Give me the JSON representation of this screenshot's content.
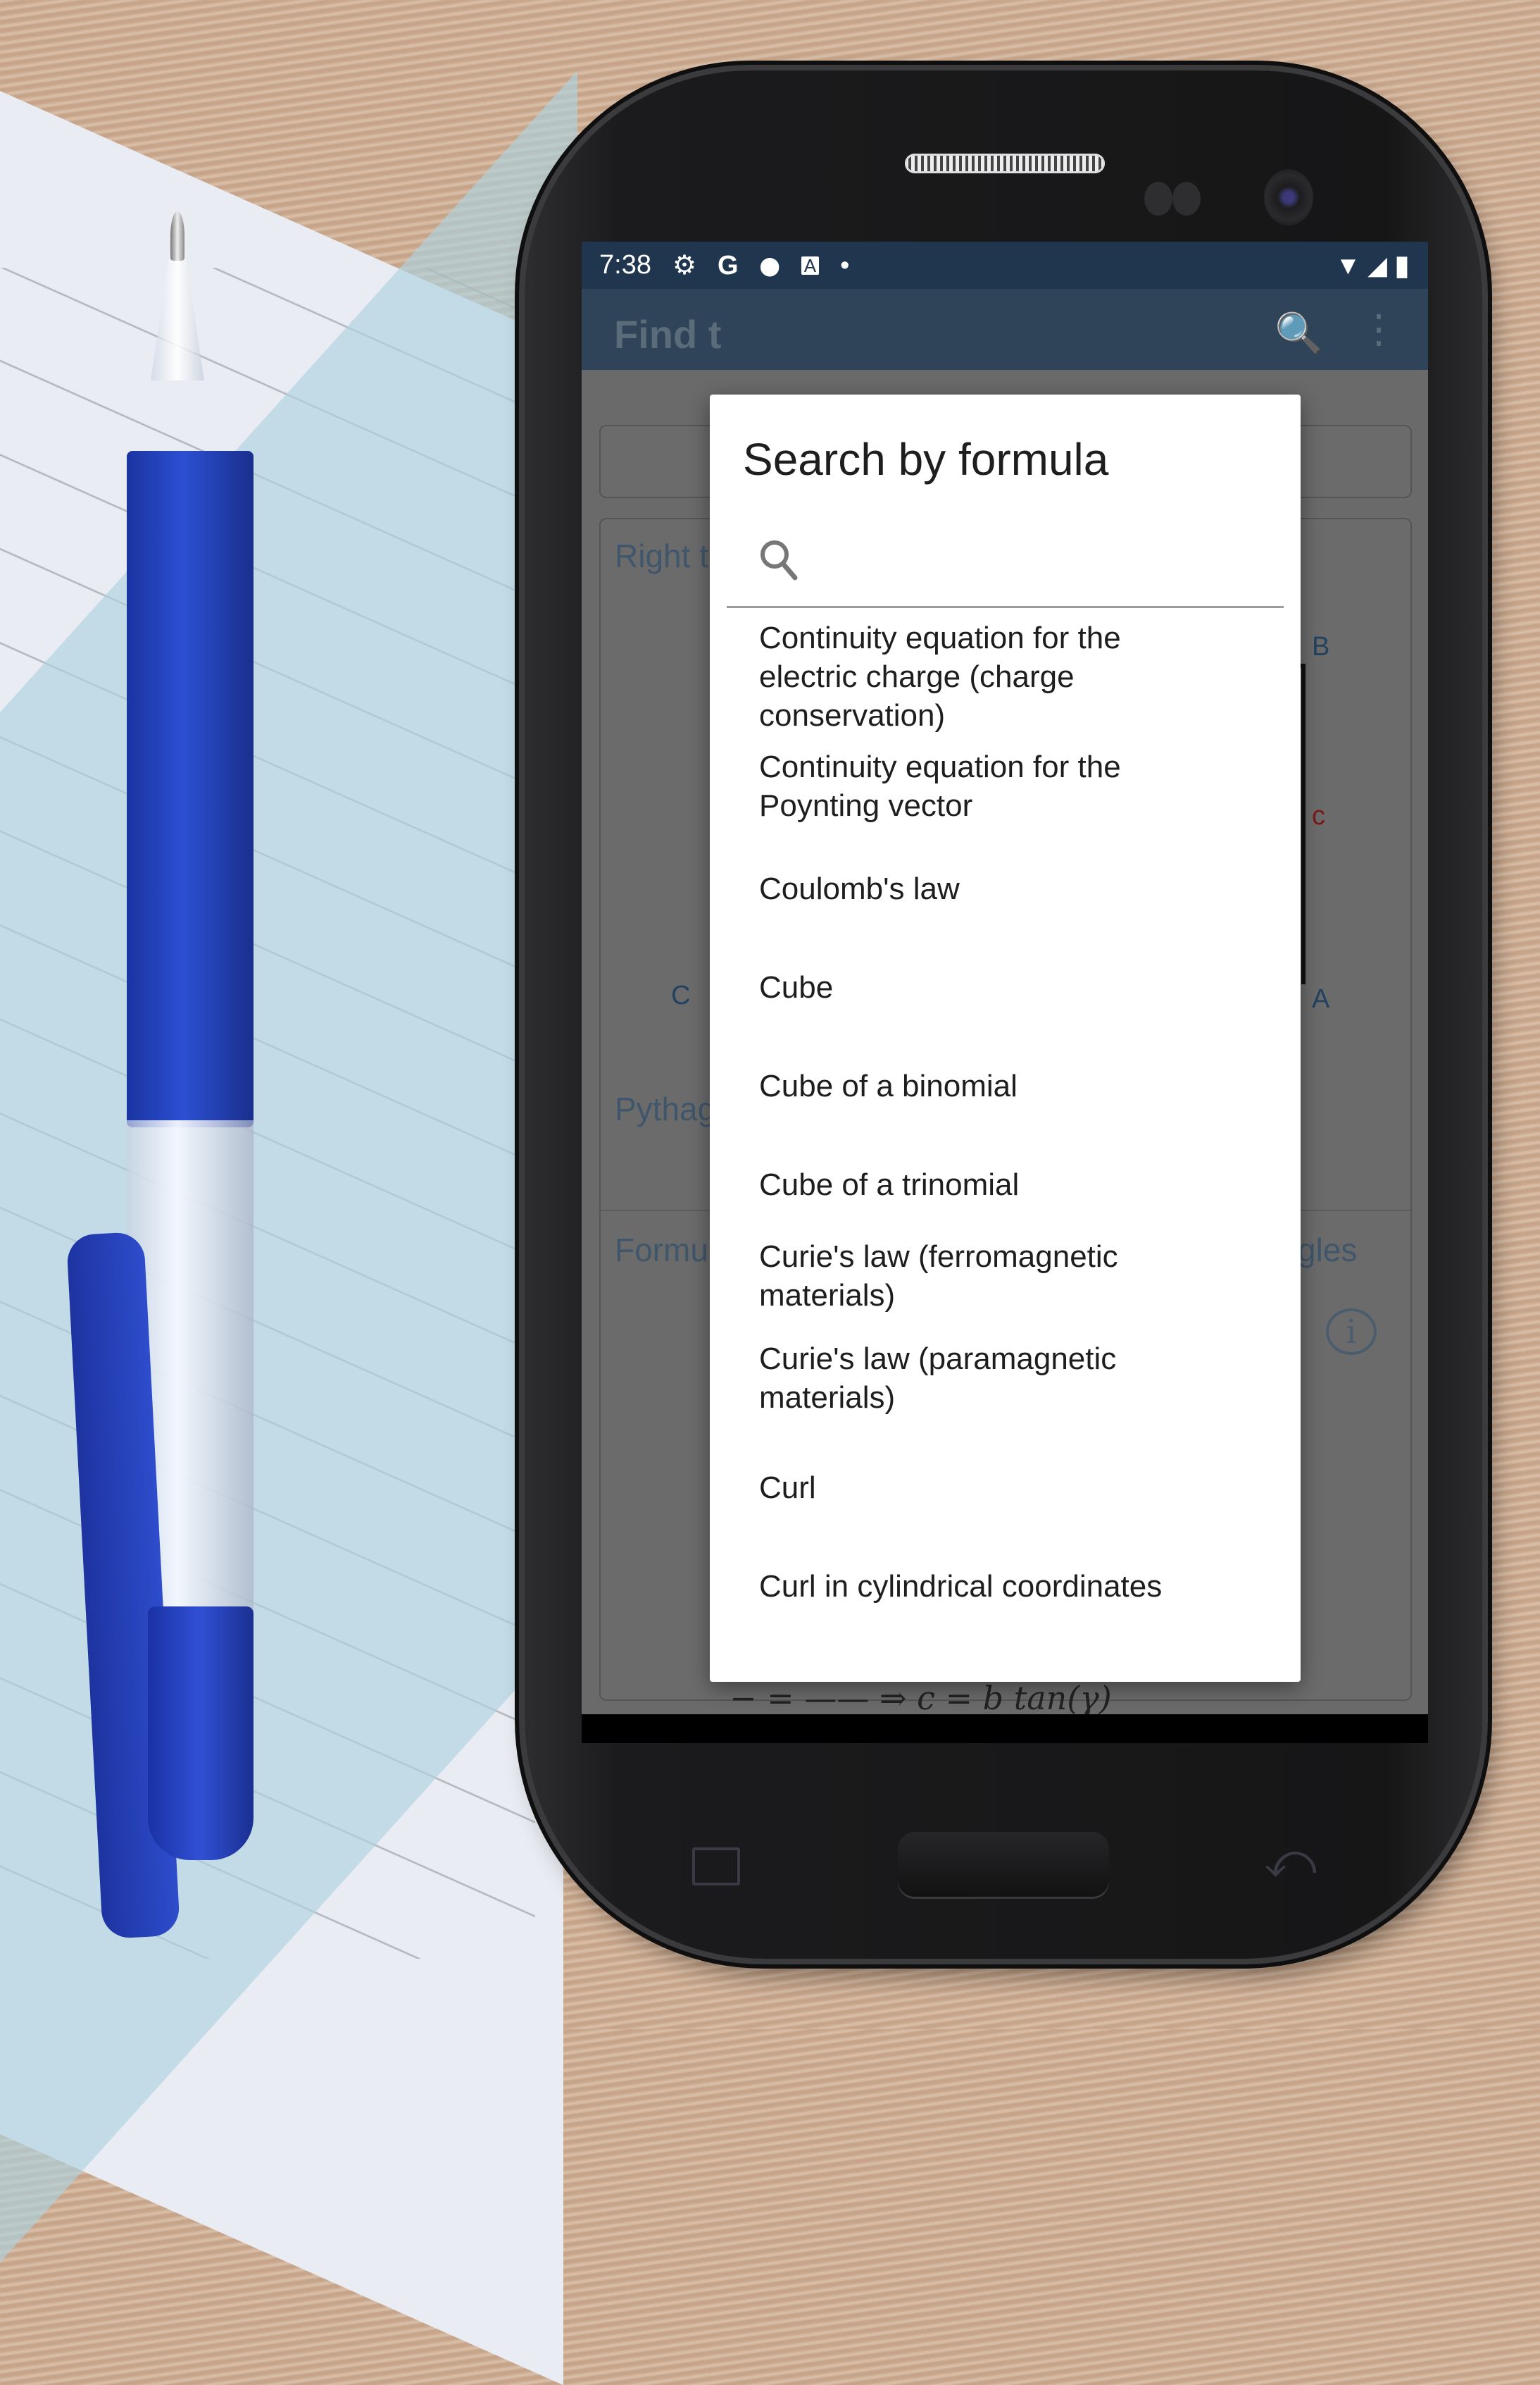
{
  "status_bar": {
    "time": "7:38",
    "left_icons": [
      "gear-icon",
      "google-g-icon",
      "location-pin-icon",
      "keyboard-a-icon",
      "dot-icon"
    ],
    "right_icons": [
      "wifi-icon",
      "signal-icon",
      "battery-icon"
    ],
    "glyphs": {
      "gear": "⚙",
      "google": "G",
      "pin": "⬤",
      "a": "A",
      "dot": "•",
      "wifi": "▼",
      "signal": "◢",
      "battery": "▮"
    }
  },
  "app": {
    "title": "Find t",
    "search_glyph": "🔍",
    "menu_glyph": "⋮",
    "card": {
      "heading": "Right t",
      "vertex_b": "B",
      "side_c": "c",
      "vertex_c": "C",
      "vertex_a": "A",
      "section_pythagoras": "Pythag",
      "info_glyph": "i",
      "section_formulas_left": "Formu",
      "section_formulas_right": "gles",
      "math_peek": "− = ——    ⇒   c = b tan(γ)"
    }
  },
  "dialog": {
    "title": "Search by formula",
    "search": {
      "value": "",
      "placeholder": ""
    },
    "items": [
      {
        "label": "Continuity equation for the electric charge (charge conservation)",
        "lines": [
          "Continuity equation for the",
          "electric charge (charge",
          "conservation)"
        ]
      },
      {
        "label": "Continuity equation for the Poynting vector",
        "lines": [
          "Continuity equation for the",
          "Poynting vector"
        ]
      },
      {
        "label": "Coulomb's law",
        "lines": [
          "Coulomb's law"
        ]
      },
      {
        "label": "Cube",
        "lines": [
          "Cube"
        ]
      },
      {
        "label": "Cube of a binomial",
        "lines": [
          "Cube of a binomial"
        ]
      },
      {
        "label": "Cube of a trinomial",
        "lines": [
          "Cube of a trinomial"
        ]
      },
      {
        "label": "Curie's law (ferromagnetic materials)",
        "lines": [
          "Curie's law (ferromagnetic",
          "materials)"
        ]
      },
      {
        "label": "Curie's law (paramagnetic materials)",
        "lines": [
          "Curie's law (paramagnetic",
          "materials)"
        ]
      },
      {
        "label": "Curl",
        "lines": [
          "Curl"
        ]
      },
      {
        "label": "Curl in cylindrical coordinates",
        "lines": [
          "Curl in cylindrical coordinates"
        ]
      }
    ]
  },
  "navbar": {
    "back": "back",
    "home": "home",
    "recents": "recents"
  },
  "hardware_keys": {
    "back_glyph": "⤺"
  },
  "colors": {
    "status_bar": "#1f364e",
    "app_bar_dimmed": "#2f4459",
    "scrim": "#6a6a6a",
    "dialog_bg": "#ffffff",
    "text": "#1e1e1e",
    "accent_label": "#3f566b",
    "side_c": "#7a1a1a"
  }
}
